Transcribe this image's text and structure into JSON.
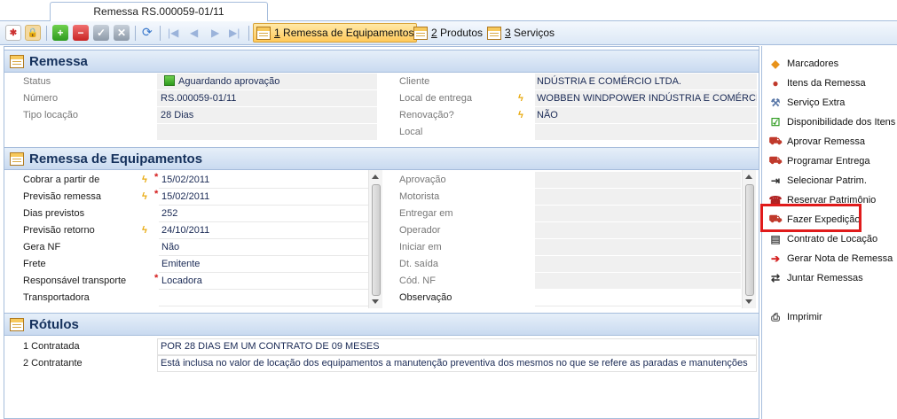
{
  "window_tab": "Remessa RS.000059-01/11",
  "toolbar": {
    "tabs": [
      {
        "num": "1",
        "label": " Remessa de Equipamentos"
      },
      {
        "num": "2",
        "label": " Produtos"
      },
      {
        "num": "3",
        "label": " Serviços"
      }
    ]
  },
  "remessa": {
    "title": "Remessa",
    "status_label": "Status",
    "status_value": "Aguardando aprovação",
    "numero_label": "Número",
    "numero_value": "RS.000059-01/11",
    "tipo_label": "Tipo locação",
    "tipo_value": "28 Dias",
    "cliente_label": "Cliente",
    "cliente_value": "NDÚSTRIA E COMÉRCIO LTDA.",
    "local_entrega_label": "Local de entrega",
    "local_entrega_value": "WOBBEN WINDPOWER INDÚSTRIA E COMÉRCIO LT",
    "renovacao_label": "Renovação?",
    "renovacao_value": "NÃO",
    "local_label": "Local",
    "local_value": ""
  },
  "equipamentos": {
    "title": "Remessa de Equipamentos",
    "left": [
      {
        "label": "Cobrar a partir de",
        "value": "15/02/2011"
      },
      {
        "label": "Previsão remessa",
        "value": "15/02/2011"
      },
      {
        "label": "Dias previstos",
        "value": "252"
      },
      {
        "label": "Previsão retorno",
        "value": "24/10/2011"
      },
      {
        "label": "Gera NF",
        "value": "Não"
      },
      {
        "label": "Frete",
        "value": "Emitente"
      },
      {
        "label": "Responsável transporte",
        "value": "Locadora"
      },
      {
        "label": "Transportadora",
        "value": ""
      }
    ],
    "right": [
      {
        "label": "Aprovação",
        "value": ""
      },
      {
        "label": "Motorista",
        "value": ""
      },
      {
        "label": "Entregar em",
        "value": ""
      },
      {
        "label": "Operador",
        "value": ""
      },
      {
        "label": "Iniciar em",
        "value": ""
      },
      {
        "label": "Dt. saída",
        "value": ""
      },
      {
        "label": "Cód. NF",
        "value": ""
      },
      {
        "label": "Observação",
        "value": ""
      }
    ]
  },
  "rotulos": {
    "title": "Rótulos",
    "rows": [
      {
        "label": "1 Contratada",
        "value": "POR 28 DIAS EM UM CONTRATO DE 09 MESES"
      },
      {
        "label": "2 Contratante",
        "value": "Está inclusa no valor de locação dos equipamentos a manutenção preventiva dos mesmos no que se refere as paradas e manutenções"
      }
    ]
  },
  "sidebar": {
    "items": [
      {
        "label": "Marcadores",
        "icon": "tag-icon"
      },
      {
        "label": "Itens da Remessa",
        "icon": "people-icon"
      },
      {
        "label": "Serviço Extra",
        "icon": "wrench-icon"
      },
      {
        "label": "Disponibilidade dos Itens",
        "icon": "checklist-icon"
      },
      {
        "label": "Aprovar Remessa",
        "icon": "truck-check-icon"
      },
      {
        "label": "Programar Entrega",
        "icon": "truck-calendar-icon"
      },
      {
        "label": "Selecionar Patrim.",
        "icon": "select-icon"
      },
      {
        "label": "Reservar Patrimônio",
        "icon": "phone-icon"
      },
      {
        "label": "Fazer Expedição",
        "icon": "truck-ship-icon"
      },
      {
        "label": "Contrato de Locação",
        "icon": "document-icon"
      },
      {
        "label": "Gerar Nota de Remessa",
        "icon": "note-arrow-icon"
      },
      {
        "label": "Juntar Remessas",
        "icon": "merge-icon"
      },
      {
        "label": "Imprimir",
        "icon": "printer-icon"
      }
    ]
  }
}
